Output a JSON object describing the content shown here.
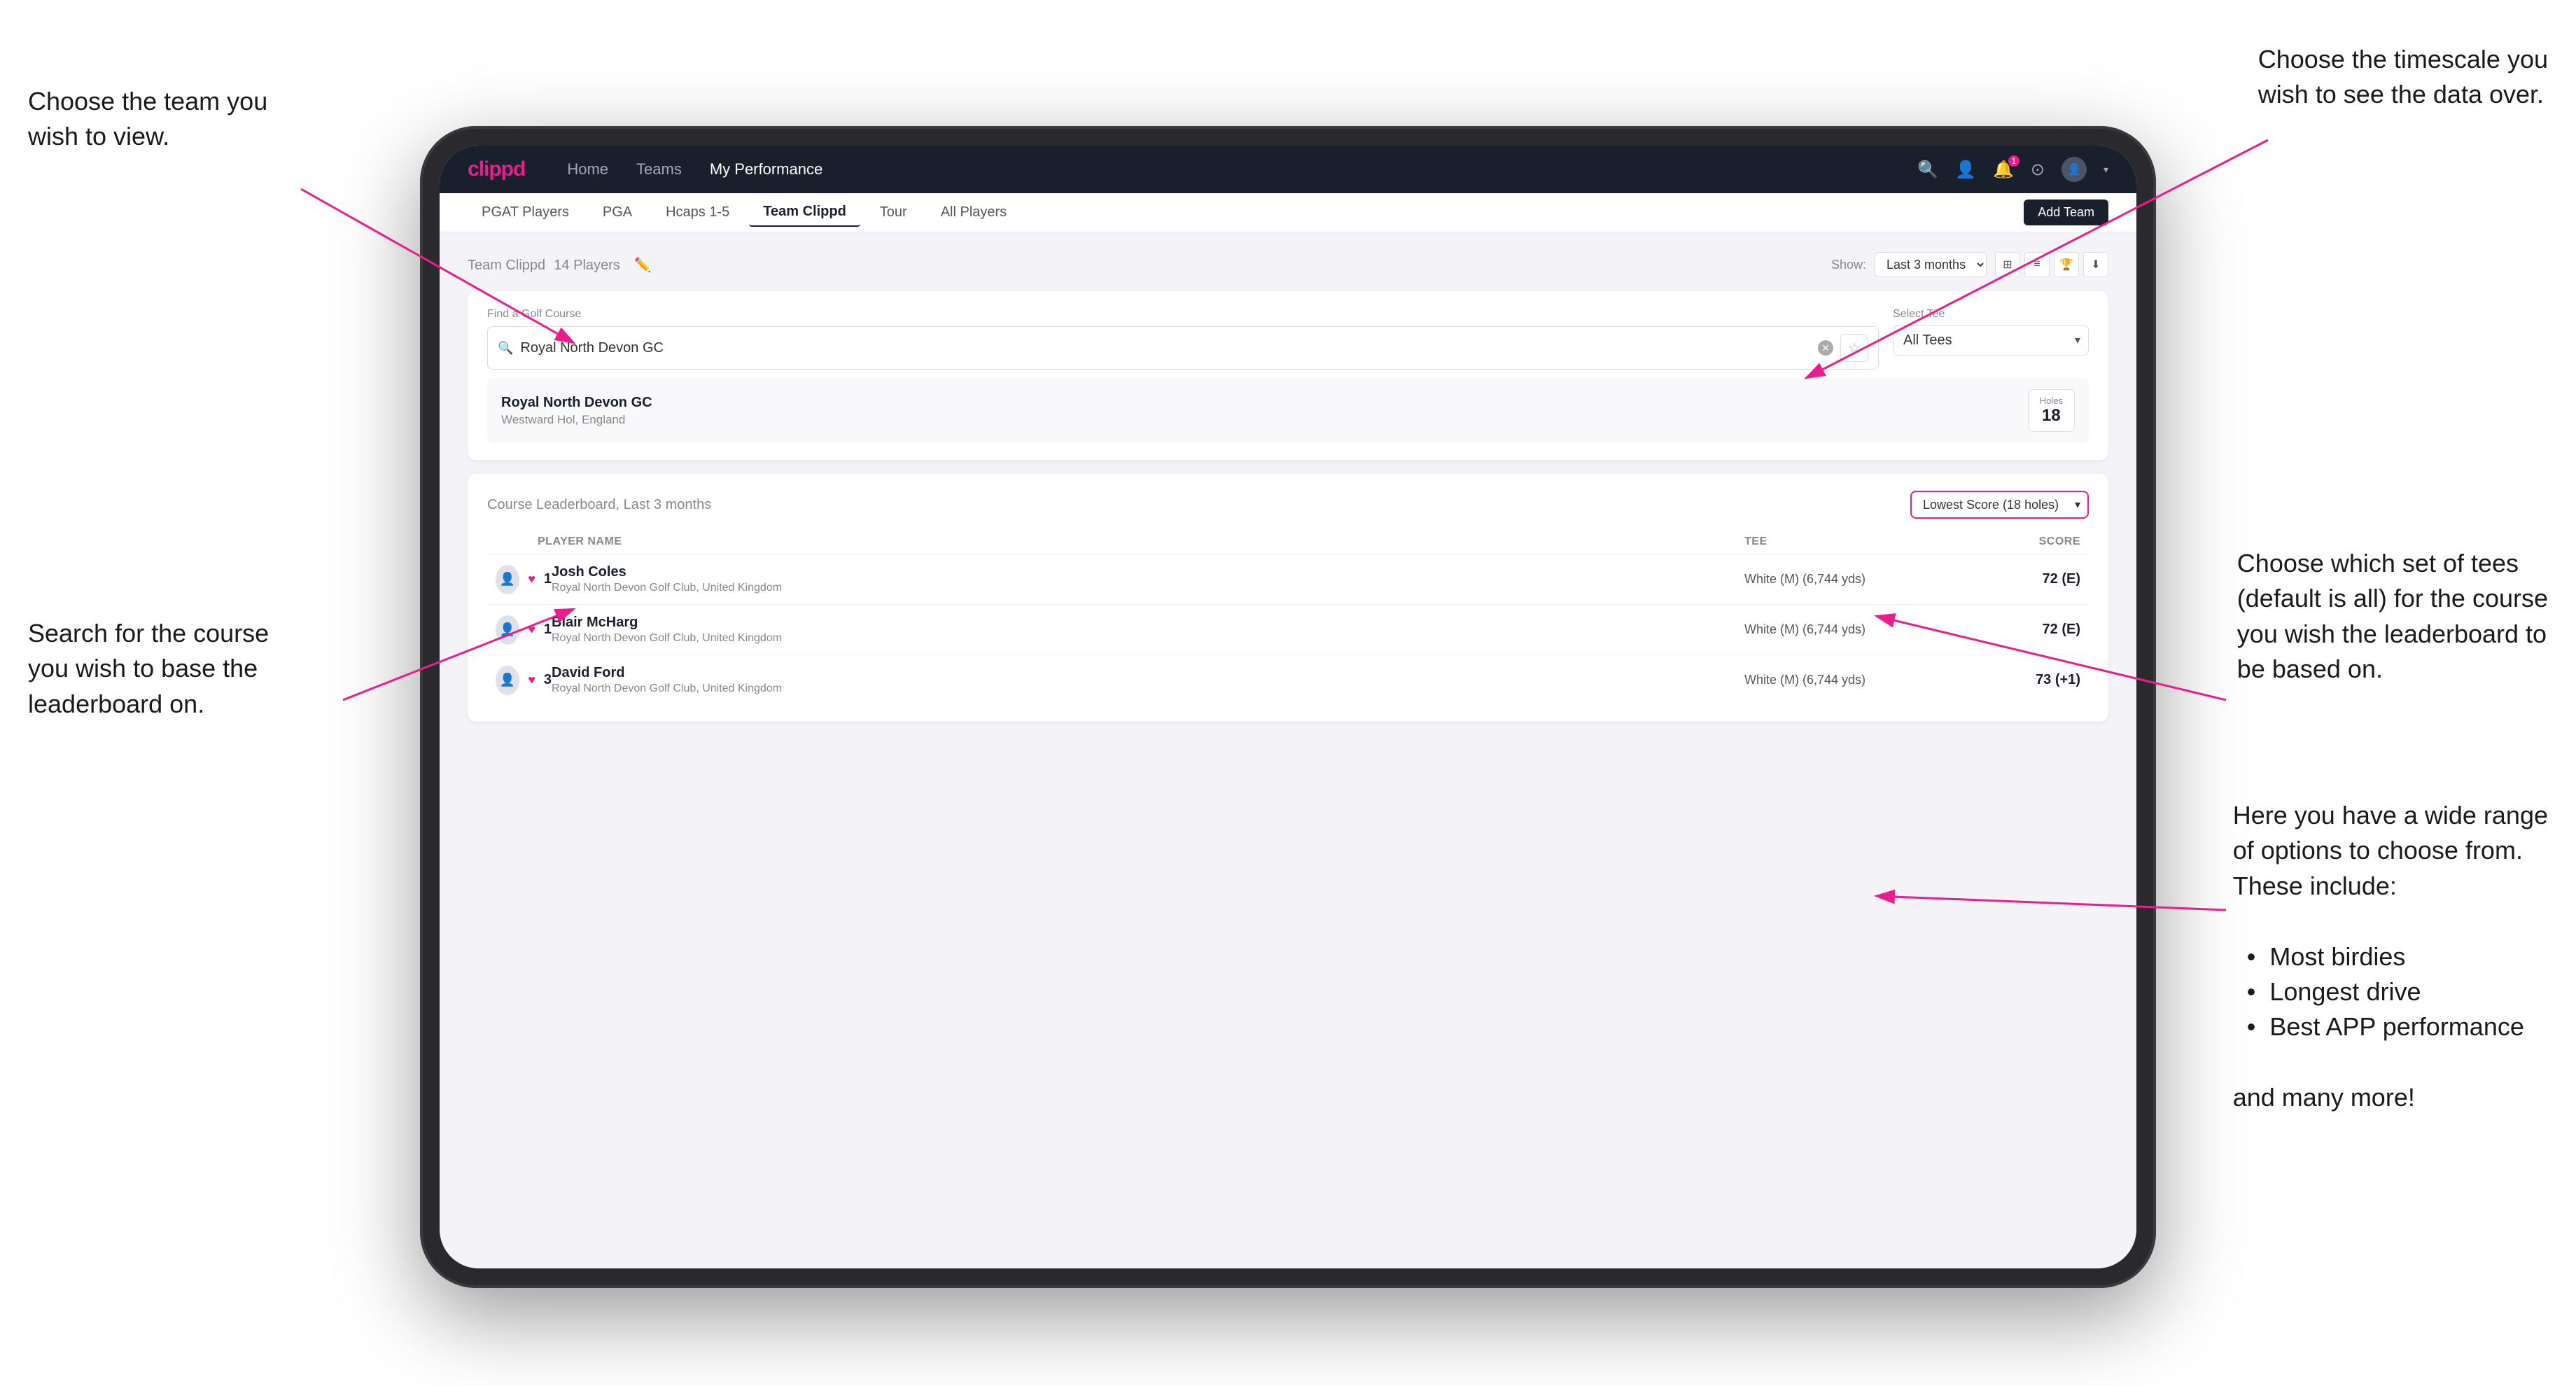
{
  "page": {
    "background": "#ffffff"
  },
  "annotations": {
    "top_left": {
      "title": "Choose the team you\nwish to view.",
      "top_right": "Choose the timescale you\nwish to see the data over.",
      "bottom_left_title": "Search for the course\nyou wish to base the\nleaderboard on.",
      "bottom_right_title": "Choose which set of tees\n(default is all) for the course\nyou wish the leaderboard to\nbe based on.",
      "options_title": "Here you have a wide range\nof options to choose from.\nThese include:",
      "options_list": [
        "Most birdies",
        "Longest drive",
        "Best APP performance"
      ],
      "options_footer": "and many more!"
    }
  },
  "nav": {
    "logo": "clippd",
    "links": [
      "Home",
      "Teams",
      "My Performance"
    ],
    "active_link": "My Performance",
    "icons": [
      "search",
      "people",
      "bell",
      "settings",
      "avatar"
    ]
  },
  "sub_nav": {
    "items": [
      "PGAT Players",
      "PGA",
      "Hcaps 1-5",
      "Team Clippd",
      "Tour",
      "All Players"
    ],
    "active_item": "Team Clippd",
    "add_team_label": "Add Team"
  },
  "team_header": {
    "title": "Team Clippd",
    "player_count": "14 Players",
    "show_label": "Show:",
    "show_value": "Last 3 months",
    "view_options": [
      "grid",
      "list",
      "trophy",
      "download"
    ]
  },
  "course_search": {
    "find_label": "Find a Golf Course",
    "search_value": "Royal North Devon GC",
    "select_tee_label": "Select Tee",
    "tee_value": "All Tees",
    "result": {
      "name": "Royal North Devon GC",
      "location": "Westward Hol, England",
      "holes_label": "Holes",
      "holes_value": "18"
    }
  },
  "leaderboard": {
    "title": "Course Leaderboard,",
    "period": "Last 3 months",
    "score_type": "Lowest Score (18 holes)",
    "column_headers": [
      "PLAYER NAME",
      "TEE",
      "SCORE"
    ],
    "rows": [
      {
        "rank": "1",
        "name": "Josh Coles",
        "club": "Royal North Devon Golf Club, United Kingdom",
        "tee": "White (M) (6,744 yds)",
        "score": "72 (E)"
      },
      {
        "rank": "1",
        "name": "Blair McHarg",
        "club": "Royal North Devon Golf Club, United Kingdom",
        "tee": "White (M) (6,744 yds)",
        "score": "72 (E)"
      },
      {
        "rank": "3",
        "name": "David Ford",
        "club": "Royal North Devon Golf Club, United Kingdom",
        "tee": "White (M) (6,744 yds)",
        "score": "73 (+1)"
      }
    ]
  },
  "bullet_options": {
    "items": [
      "Most birdies",
      "Longest drive",
      "Best APP performance"
    ],
    "footer": "and many more!"
  }
}
